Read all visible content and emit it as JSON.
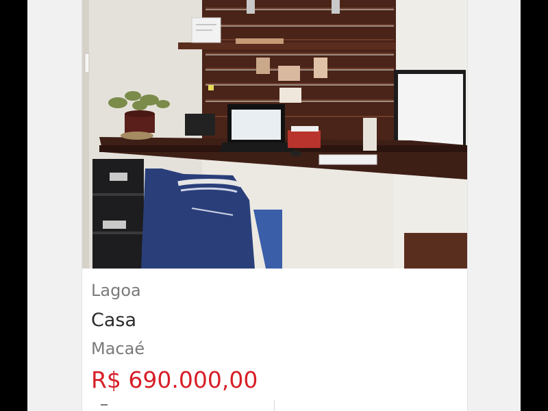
{
  "listing": {
    "neighborhood": "Lagoa",
    "property_type": "Casa",
    "city": "Macaé",
    "price": "R$ 690.000,00",
    "photo": {
      "description_icon": "property-photo",
      "colors": {
        "wall": "#e9e6df",
        "wood": "#4a2418",
        "desk": "#3e1f16",
        "shirt": "#2a3f7a",
        "chair_seat": "#3a5ea8",
        "monitor": "#1c1c1c"
      }
    }
  },
  "theme": {
    "price_color": "#d71e27",
    "muted_text": "#7a7a7a",
    "primary_text": "#2b2b2b",
    "letterbox": "#000000"
  }
}
